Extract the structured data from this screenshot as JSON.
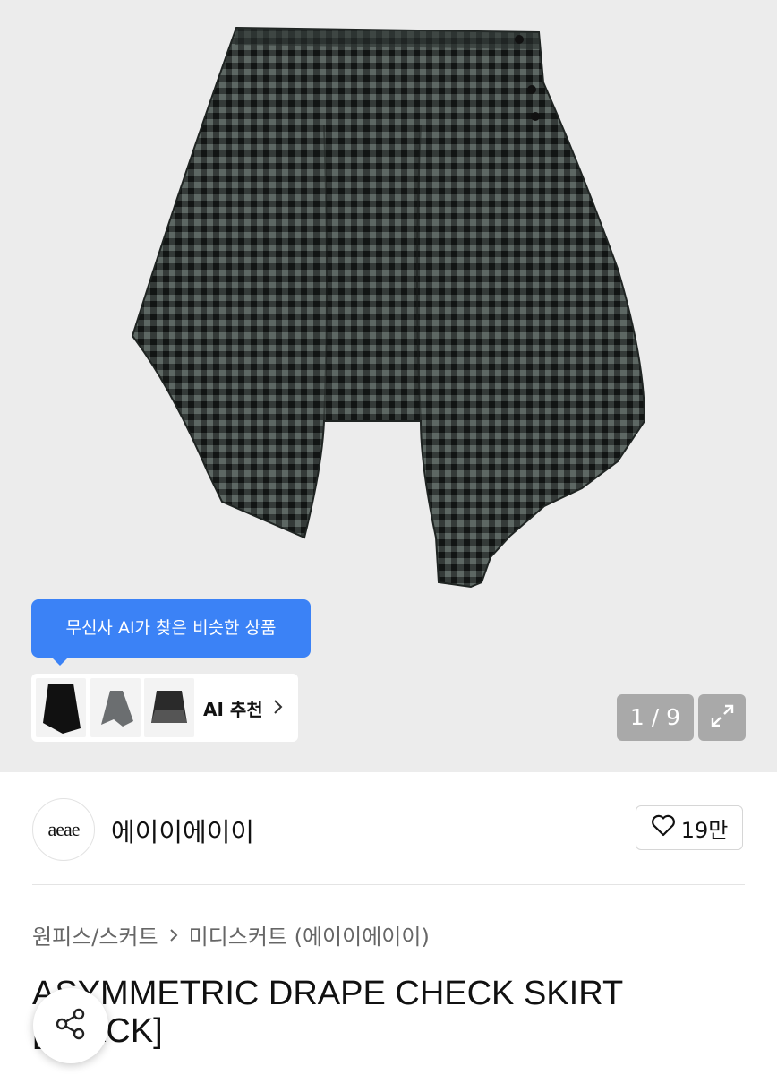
{
  "gallery": {
    "image_alt": "asymmetric drape check skirt",
    "ai_tooltip": "무신사 AI가 찾은 비슷한 상품",
    "ai_recommend_label": "AI 추천",
    "counter": "1 / 9",
    "expand_icon": "expand-icon"
  },
  "brand": {
    "logo_text": "aeae",
    "name": "에이이에이이",
    "likes": "19만"
  },
  "breadcrumb": {
    "category": "원피스/스커트",
    "subcategory": "미디스커트 (에이이에이이)"
  },
  "product": {
    "title": "ASYMMETRIC DRAPE CHECK SKIRT [BLACK]"
  },
  "colors": {
    "accent": "#3b82f6",
    "hero_bg": "#ececec",
    "overlay_button": "#a9a9a9"
  }
}
